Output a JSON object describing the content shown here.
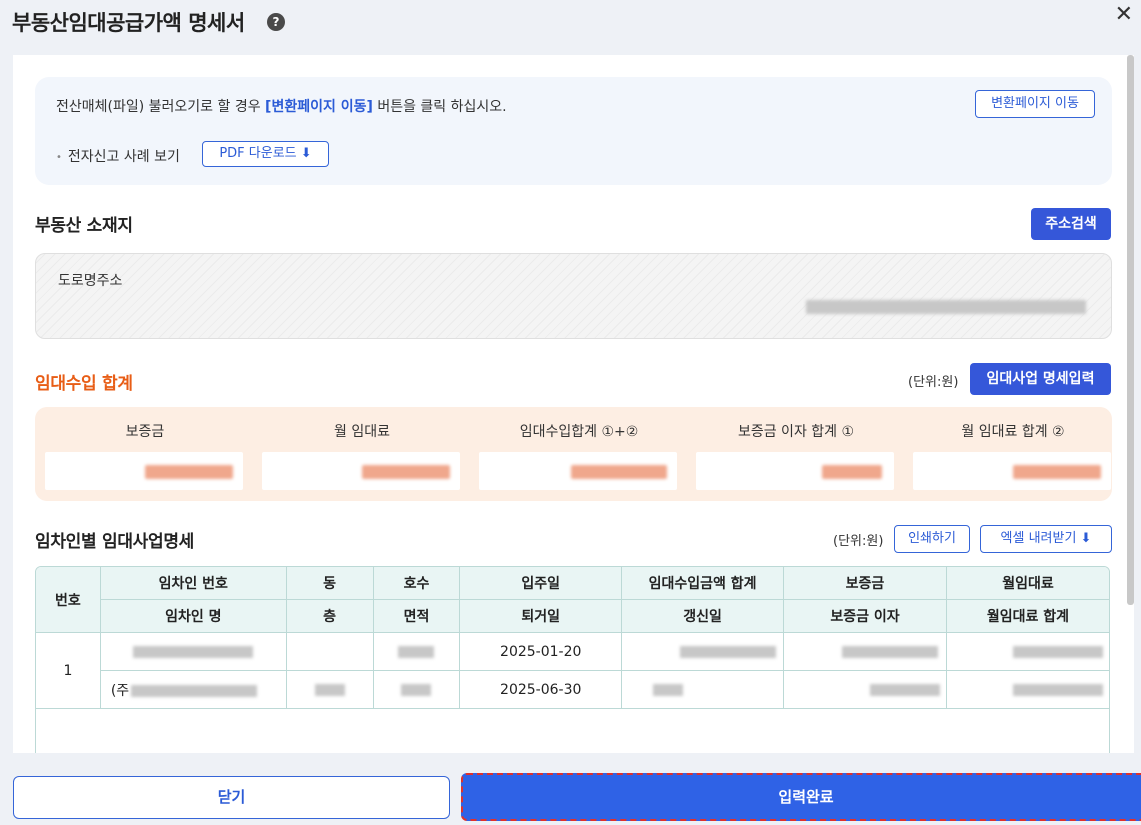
{
  "window": {
    "title": "부동산임대공급가액 명세서",
    "help_glyph": "?",
    "close_glyph": "✕"
  },
  "notice": {
    "text_before": "전산매체(파일) 불러오기로 할 경우 ",
    "text_highlight": "[변환페이지 이동]",
    "text_after": " 버튼을 클릭 하십시오.",
    "convert_button": "변환페이지 이동",
    "example_label": "전자신고 사례 보기",
    "pdf_button": "PDF 다운로드 ⬇"
  },
  "property": {
    "section_title": "부동산 소재지",
    "search_button": "주소검색",
    "road_address_label": "도로명주소"
  },
  "income": {
    "section_title": "임대수입 합계",
    "unit": "(단위:원)",
    "detail_button": "임대사업 명세입력",
    "columns": [
      "보증금",
      "월 임대료",
      "임대수입합계 ①+②",
      "보증금 이자 합계 ①",
      "월 임대료 합계 ②"
    ]
  },
  "tenants": {
    "section_title": "임차인별 임대사업명세",
    "unit": "(단위:원)",
    "print_button": "인쇄하기",
    "excel_button": "엑셀 내려받기 ⬇",
    "header_top": [
      "번호",
      "임차인 번호",
      "동",
      "호수",
      "입주일",
      "임대수입금액 합계",
      "보증금",
      "월임대료"
    ],
    "header_bottom": [
      "임차인 명",
      "층",
      "면적",
      "퇴거일",
      "갱신일",
      "보증금 이자",
      "월임대료 합계"
    ],
    "rows": [
      {
        "no": "1",
        "move_in": "2025-01-20",
        "move_out": "2025-06-30",
        "name_prefix": "(주"
      }
    ]
  },
  "footer": {
    "close_button": "닫기",
    "submit_button": "입력완료"
  },
  "colors": {
    "primary": "#2f62e6",
    "accent_orange": "#e85d16",
    "income_bg": "#fdeee3",
    "notice_bg": "#f2f6fc",
    "table_header_bg": "#e9f5f4"
  }
}
